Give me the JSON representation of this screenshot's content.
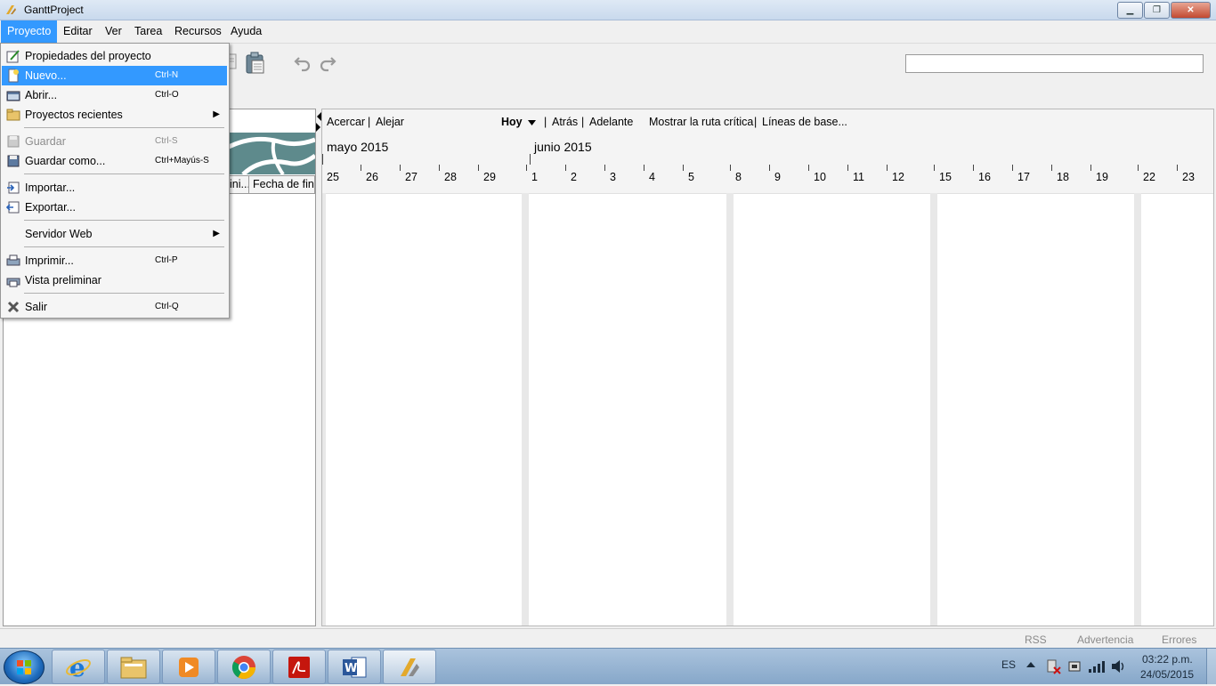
{
  "window": {
    "title": "GanttProject",
    "minimize": "▁",
    "maximize": "❐",
    "close": "✕"
  },
  "menubar": {
    "items": [
      {
        "label": "Proyecto"
      },
      {
        "label": "Editar"
      },
      {
        "label": "Ver"
      },
      {
        "label": "Tarea"
      },
      {
        "label": "Recursos"
      },
      {
        "label": "Ayuda"
      }
    ]
  },
  "dropdown": {
    "items": [
      {
        "label": "Propiedades del proyecto",
        "shortcut": "",
        "icon": "properties-icon"
      },
      {
        "label": "Nuevo...",
        "shortcut": "Ctrl-N",
        "icon": "new-file-icon"
      },
      {
        "label": "Abrir...",
        "shortcut": "Ctrl-O",
        "icon": "open-folder-icon"
      },
      {
        "label": "Proyectos recientes",
        "shortcut": "",
        "icon": "recent-folder-icon"
      },
      {
        "label": "Guardar",
        "shortcut": "Ctrl-S",
        "icon": "save-icon"
      },
      {
        "label": "Guardar como...",
        "shortcut": "Ctrl+Mayús-S",
        "icon": "save-as-icon"
      },
      {
        "label": "Importar...",
        "shortcut": "",
        "icon": "import-icon"
      },
      {
        "label": "Exportar...",
        "shortcut": "",
        "icon": "export-icon"
      },
      {
        "label": "Servidor Web",
        "shortcut": "",
        "icon": ""
      },
      {
        "label": "Imprimir...",
        "shortcut": "Ctrl-P",
        "icon": "print-icon"
      },
      {
        "label": "Vista preliminar",
        "shortcut": "",
        "icon": "print-preview-icon"
      },
      {
        "label": "Salir",
        "shortcut": "Ctrl-Q",
        "icon": "exit-icon"
      }
    ]
  },
  "tasktable": {
    "columns": [
      "Fecha de ini...",
      "Fecha de fin"
    ],
    "col_visible": [
      "ini...",
      "Fecha de fin"
    ]
  },
  "gantt": {
    "zoom_in": "Acercar",
    "zoom_out": "Alejar",
    "today": "Hoy",
    "back": "Atrás",
    "forward": "Adelante",
    "critical_path": "Mostrar la ruta crítica",
    "baselines": "Líneas de base...",
    "separator": "|",
    "months": [
      "mayo 2015",
      "junio 2015"
    ],
    "days": [
      "25",
      "26",
      "27",
      "28",
      "29",
      "1",
      "2",
      "3",
      "4",
      "5",
      "8",
      "9",
      "10",
      "11",
      "12",
      "15",
      "16",
      "17",
      "18",
      "19",
      "22",
      "23"
    ]
  },
  "status": {
    "rss": "RSS",
    "warning": "Advertencia",
    "errors": "Errores"
  },
  "taskbar": {
    "apps": [
      "internet-explorer-icon",
      "file-explorer-icon",
      "media-player-icon",
      "chrome-icon",
      "acrobat-icon",
      "word-icon",
      "ganttproject-icon"
    ],
    "language": "ES",
    "time": "03:22 p.m.",
    "date": "24/05/2015"
  },
  "colors": {
    "highlight": "#3399ff",
    "banner": "#5e8a8c"
  }
}
